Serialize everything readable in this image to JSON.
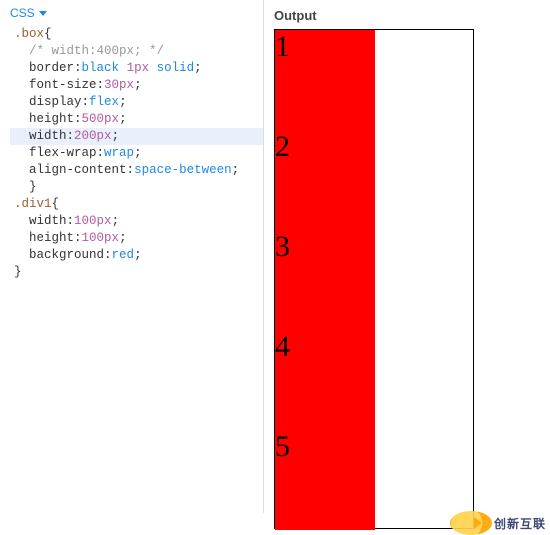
{
  "header": {
    "active_tab": "CSS"
  },
  "code_lines": [
    {
      "t": ".box{",
      "cls": "line",
      "segs": [
        [
          "sel",
          ".box"
        ],
        [
          "punct",
          "{"
        ]
      ]
    },
    {
      "t": "  /* width:400px; */",
      "cls": "line",
      "segs": [
        [
          "plain",
          "  "
        ],
        [
          "comment",
          "/* width:400px; */"
        ]
      ]
    },
    {
      "t": "  border:black 1px solid;",
      "cls": "line",
      "segs": [
        [
          "plain",
          "  "
        ],
        [
          "prop",
          "border"
        ],
        [
          "punct",
          ":"
        ],
        [
          "val-kw",
          "black "
        ],
        [
          "val-num",
          "1px"
        ],
        [
          "plain",
          " "
        ],
        [
          "val-kw",
          "solid"
        ],
        [
          "punct",
          ";"
        ]
      ]
    },
    {
      "t": "  font-size:30px;",
      "cls": "line",
      "segs": [
        [
          "plain",
          "  "
        ],
        [
          "prop",
          "font-size"
        ],
        [
          "punct",
          ":"
        ],
        [
          "val-num",
          "30px"
        ],
        [
          "punct",
          ";"
        ]
      ]
    },
    {
      "t": "  display:flex;",
      "cls": "line",
      "segs": [
        [
          "plain",
          "  "
        ],
        [
          "prop",
          "display"
        ],
        [
          "punct",
          ":"
        ],
        [
          "val-kw",
          "flex"
        ],
        [
          "punct",
          ";"
        ]
      ]
    },
    {
      "t": "  height:500px;",
      "cls": "line",
      "segs": [
        [
          "plain",
          "  "
        ],
        [
          "prop",
          "height"
        ],
        [
          "punct",
          ":"
        ],
        [
          "val-num",
          "500px"
        ],
        [
          "punct",
          ";"
        ]
      ]
    },
    {
      "t": "  width:200px;",
      "cls": "line hl",
      "segs": [
        [
          "plain",
          "  "
        ],
        [
          "prop",
          "width"
        ],
        [
          "punct",
          ":"
        ],
        [
          "val-num",
          "200px"
        ],
        [
          "punct",
          ";"
        ]
      ]
    },
    {
      "t": "  flex-wrap:wrap;",
      "cls": "line",
      "segs": [
        [
          "plain",
          "  "
        ],
        [
          "prop",
          "flex-wrap"
        ],
        [
          "punct",
          ":"
        ],
        [
          "val-kw",
          "wrap"
        ],
        [
          "punct",
          ";"
        ]
      ]
    },
    {
      "t": "  align-content:space-between;",
      "cls": "line",
      "segs": [
        [
          "plain",
          "  "
        ],
        [
          "prop",
          "align-content"
        ],
        [
          "punct",
          ":"
        ],
        [
          "val-kw",
          "space-between"
        ],
        [
          "punct",
          ";"
        ]
      ]
    },
    {
      "t": "  }",
      "cls": "line",
      "segs": [
        [
          "plain",
          "  "
        ],
        [
          "punct",
          "}"
        ]
      ]
    },
    {
      "t": ".div1{",
      "cls": "line",
      "segs": [
        [
          "sel",
          ".div1"
        ],
        [
          "punct",
          "{"
        ]
      ]
    },
    {
      "t": "  width:100px;",
      "cls": "line",
      "segs": [
        [
          "plain",
          "  "
        ],
        [
          "prop",
          "width"
        ],
        [
          "punct",
          ":"
        ],
        [
          "val-num",
          "100px"
        ],
        [
          "punct",
          ";"
        ]
      ]
    },
    {
      "t": "  height:100px;",
      "cls": "line",
      "segs": [
        [
          "plain",
          "  "
        ],
        [
          "prop",
          "height"
        ],
        [
          "punct",
          ":"
        ],
        [
          "val-num",
          "100px"
        ],
        [
          "punct",
          ";"
        ]
      ]
    },
    {
      "t": "  background:red;",
      "cls": "line",
      "segs": [
        [
          "plain",
          "  "
        ],
        [
          "prop",
          "background"
        ],
        [
          "punct",
          ":"
        ],
        [
          "val-kw",
          "red"
        ],
        [
          "punct",
          ";"
        ]
      ]
    },
    {
      "t": "}",
      "cls": "line",
      "segs": [
        [
          "punct",
          "}"
        ]
      ]
    }
  ],
  "output": {
    "label": "Output",
    "boxes": [
      "1",
      "2",
      "3",
      "4",
      "5"
    ]
  },
  "watermark": "创新互联"
}
